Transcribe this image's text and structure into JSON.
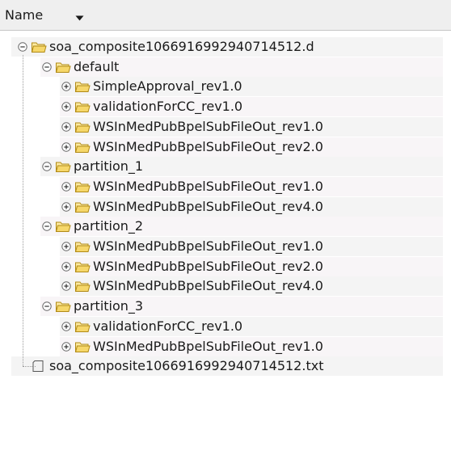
{
  "header": {
    "name_label": "Name"
  },
  "root": {
    "label": "soa_composite1066916992940714512.d",
    "children": [
      {
        "label": "default",
        "children": [
          "SimpleApproval_rev1.0",
          "validationForCC_rev1.0",
          "WSInMedPubBpelSubFileOut_rev1.0",
          "WSInMedPubBpelSubFileOut_rev2.0"
        ]
      },
      {
        "label": "partition_1",
        "children": [
          "WSInMedPubBpelSubFileOut_rev1.0",
          "WSInMedPubBpelSubFileOut_rev4.0"
        ]
      },
      {
        "label": "partition_2",
        "children": [
          "WSInMedPubBpelSubFileOut_rev1.0",
          "WSInMedPubBpelSubFileOut_rev2.0",
          "WSInMedPubBpelSubFileOut_rev4.0"
        ]
      },
      {
        "label": "partition_3",
        "children": [
          "validationForCC_rev1.0",
          "WSInMedPubBpelSubFileOut_rev1.0"
        ]
      }
    ]
  },
  "file": {
    "label": "soa_composite1066916992940714512.txt"
  },
  "colors": {
    "folder_fill": "#f6d76a",
    "folder_stroke": "#b08a16",
    "header_bg": "#efefef"
  },
  "icons": {
    "sort": "chevron-down-icon",
    "expander": "collapse-icon",
    "folder": "folder-icon",
    "file": "file-icon"
  }
}
